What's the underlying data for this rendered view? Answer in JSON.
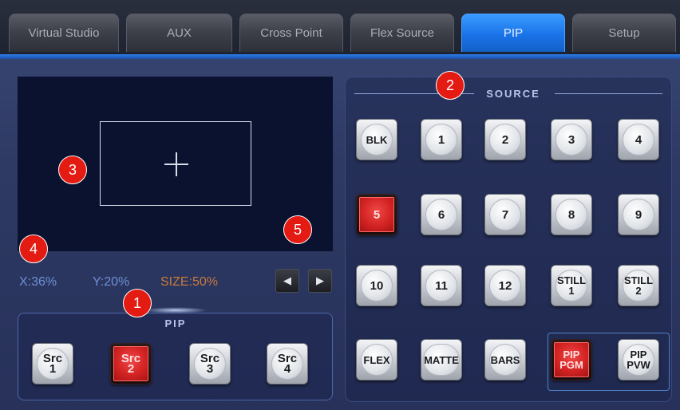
{
  "tabs": [
    {
      "label": "Virtual Studio",
      "active": false
    },
    {
      "label": "AUX",
      "active": false
    },
    {
      "label": "Cross Point",
      "active": false
    },
    {
      "label": "Flex Source",
      "active": false
    },
    {
      "label": "PIP",
      "active": true
    },
    {
      "label": "Setup",
      "active": false
    }
  ],
  "readout": {
    "x": "X:36%",
    "y": "Y:20%",
    "size": "SIZE:50%"
  },
  "pip_panel": {
    "title": "PIP",
    "buttons": [
      {
        "label": "Src\n1",
        "active": false
      },
      {
        "label": "Src\n2",
        "active": true
      },
      {
        "label": "Src\n3",
        "active": false
      },
      {
        "label": "Src\n4",
        "active": false
      }
    ]
  },
  "source_panel": {
    "title": "SOURCE",
    "buttons": [
      {
        "label": "BLK",
        "active": false
      },
      {
        "label": "1",
        "active": false
      },
      {
        "label": "2",
        "active": false
      },
      {
        "label": "3",
        "active": false
      },
      {
        "label": "4",
        "active": false
      },
      {
        "label": "5",
        "active": true
      },
      {
        "label": "6",
        "active": false
      },
      {
        "label": "7",
        "active": false
      },
      {
        "label": "8",
        "active": false
      },
      {
        "label": "9",
        "active": false
      },
      {
        "label": "10",
        "active": false
      },
      {
        "label": "11",
        "active": false
      },
      {
        "label": "12",
        "active": false
      },
      {
        "label": "STILL\n1",
        "active": false
      },
      {
        "label": "STILL\n2",
        "active": false
      },
      {
        "label": "FLEX",
        "active": false
      },
      {
        "label": "MATTE",
        "active": false
      },
      {
        "label": "BARS",
        "active": false
      },
      {
        "label": "PIP\nPGM",
        "active": true
      },
      {
        "label": "PIP\nPVW",
        "active": false
      }
    ]
  },
  "arrows": {
    "left": "◀",
    "right": "▶"
  },
  "callouts": [
    "1",
    "2",
    "3",
    "4",
    "5"
  ],
  "colors": {
    "accent": "#1a73e8",
    "active_red": "#d42424",
    "size_text": "#c97a3c",
    "xy_text": "#6f8fd6",
    "callout": "#e31b12"
  }
}
